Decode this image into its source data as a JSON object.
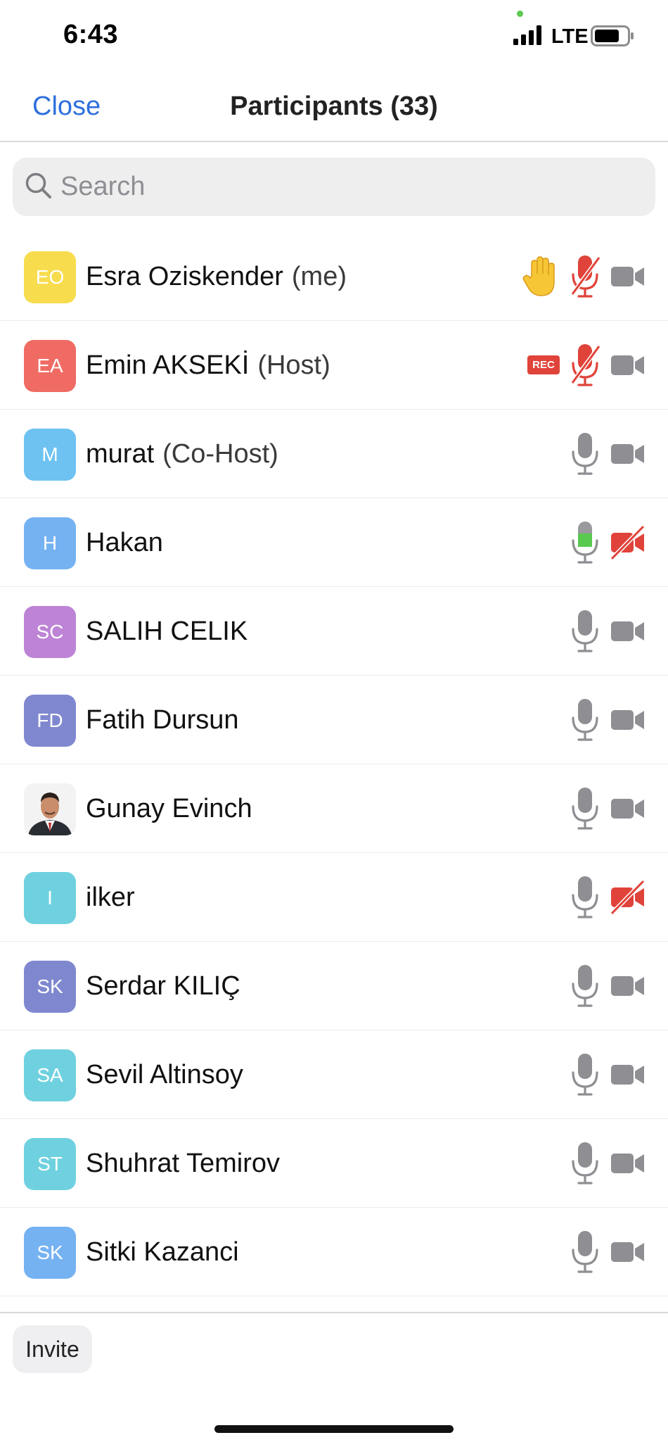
{
  "status_bar": {
    "time": "6:43",
    "network": "LTE"
  },
  "header": {
    "close_label": "Close",
    "title": "Participants (33)"
  },
  "search": {
    "placeholder": "Search",
    "value": ""
  },
  "participants": [
    {
      "initials": "EO",
      "name": "Esra Oziskender",
      "role": "(me)",
      "avatar_color": "#f7dc4e",
      "mic": "muted",
      "video": "on",
      "status": "raised-hand"
    },
    {
      "initials": "EA",
      "name": "Emin AKSEKİ",
      "role": "(Host)",
      "avatar_color": "#ef6b63",
      "mic": "muted",
      "video": "on",
      "status": "recording",
      "status_label": "REC"
    },
    {
      "initials": "M",
      "name": "murat",
      "role": "(Co-Host)",
      "avatar_color": "#6dc2f1",
      "mic": "on",
      "video": "on"
    },
    {
      "initials": "H",
      "name": "Hakan",
      "role": "",
      "avatar_color": "#75b2f2",
      "mic": "speaking",
      "video": "off"
    },
    {
      "initials": "SC",
      "name": "SALIH CELIK",
      "role": "",
      "avatar_color": "#bd84d6",
      "mic": "on",
      "video": "on"
    },
    {
      "initials": "FD",
      "name": "Fatih Dursun",
      "role": "",
      "avatar_color": "#7f88cf",
      "mic": "on",
      "video": "on"
    },
    {
      "initials": "",
      "name": "Gunay Evinch",
      "role": "",
      "avatar_color": "#f3f3f3",
      "avatar_type": "photo",
      "mic": "on",
      "video": "on"
    },
    {
      "initials": "I",
      "name": "ilker",
      "role": "",
      "avatar_color": "#6fd1df",
      "mic": "on",
      "video": "off"
    },
    {
      "initials": "SK",
      "name": "Serdar KILIÇ",
      "role": "",
      "avatar_color": "#7f88cf",
      "mic": "on",
      "video": "on"
    },
    {
      "initials": "SA",
      "name": "Sevil Altinsoy",
      "role": "",
      "avatar_color": "#6fd1df",
      "mic": "on",
      "video": "on"
    },
    {
      "initials": "ST",
      "name": "Shuhrat Temirov",
      "role": "",
      "avatar_color": "#6fd1df",
      "mic": "on",
      "video": "on"
    },
    {
      "initials": "SK",
      "name": "Sitki Kazanci",
      "role": "",
      "avatar_color": "#75b2f2",
      "mic": "on",
      "video": "on"
    }
  ],
  "footer": {
    "invite_label": "Invite"
  },
  "colors": {
    "accent": "#2f6fdd",
    "muted_red": "#e0433a",
    "speaking_green": "#5ac94f",
    "icon_gray": "#8e8e93"
  }
}
